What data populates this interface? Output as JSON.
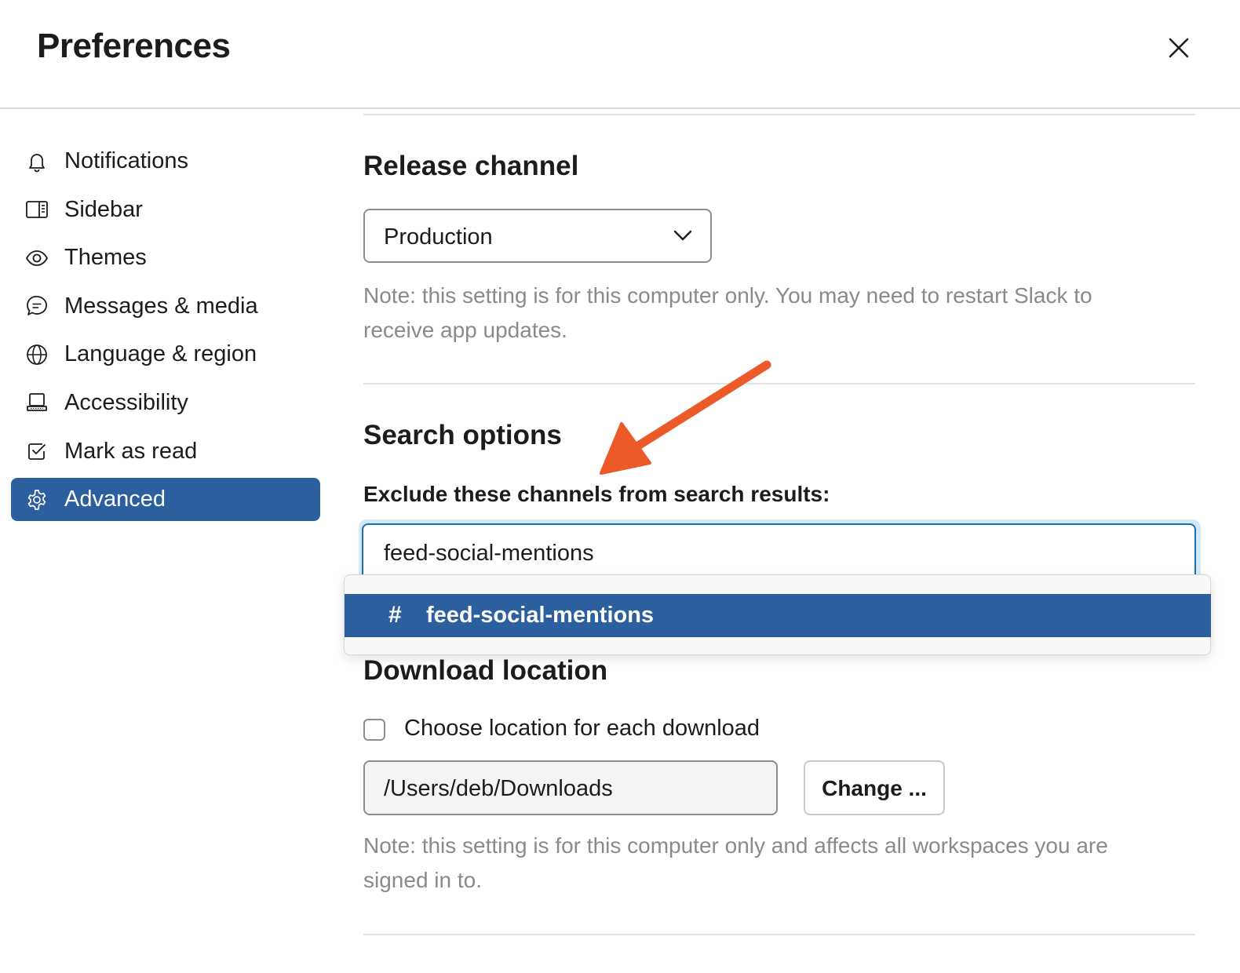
{
  "header": {
    "title": "Preferences",
    "close_icon": "close-icon"
  },
  "sidebar": {
    "items": [
      {
        "label": "Notifications",
        "icon": "bell-icon",
        "active": false
      },
      {
        "label": "Sidebar",
        "icon": "sidebar-panel-icon",
        "active": false
      },
      {
        "label": "Themes",
        "icon": "eye-icon",
        "active": false
      },
      {
        "label": "Messages & media",
        "icon": "message-bubble-icon",
        "active": false
      },
      {
        "label": "Language & region",
        "icon": "globe-icon",
        "active": false
      },
      {
        "label": "Accessibility",
        "icon": "laptop-icon",
        "active": false
      },
      {
        "label": "Mark as read",
        "icon": "checkbox-check-icon",
        "active": false
      },
      {
        "label": "Advanced",
        "icon": "gear-icon",
        "active": true
      }
    ]
  },
  "release_channel": {
    "title": "Release channel",
    "selected": "Production",
    "note": "Note: this setting is for this computer only. You may need to restart Slack to receive app updates."
  },
  "search_options": {
    "title": "Search options",
    "field_label": "Exclude these channels from search results:",
    "input_value": "feed-social-mentions",
    "suggestions": [
      {
        "prefix": "#",
        "label": "feed-social-mentions",
        "highlighted": true
      }
    ]
  },
  "download_location": {
    "title": "Download location",
    "checkbox_label": "Choose location for each download",
    "checkbox_checked": false,
    "path": "/Users/deb/Downloads",
    "change_label": "Change ...",
    "note": "Note: this setting is for this computer only and affects all workspaces you are signed in to."
  },
  "colors": {
    "accent": "#2c5f9e",
    "annotation_arrow": "#ec5a29",
    "focus_ring": "#1d6fb5",
    "note_text": "#8a8a8a"
  }
}
